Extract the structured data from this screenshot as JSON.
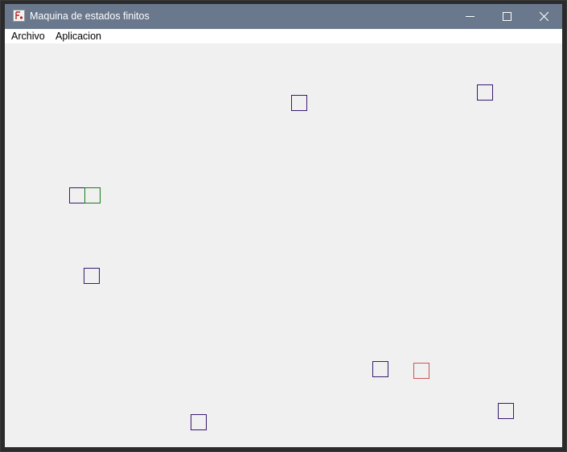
{
  "window": {
    "title": "Maquina de estados finitos",
    "controls": [
      "minimize",
      "maximize",
      "close"
    ]
  },
  "menu": {
    "items": [
      {
        "label": "Archivo"
      },
      {
        "label": "Aplicacion"
      }
    ]
  },
  "canvas": {
    "states": [
      {
        "name": "state-node-1",
        "color": "#3a1a6e"
      },
      {
        "name": "state-node-2",
        "color": "#3a1a6e"
      },
      {
        "name": "state-node-3",
        "color": "#3a1a6e"
      },
      {
        "name": "state-node-4",
        "color": "#1a7a1a"
      },
      {
        "name": "state-node-5",
        "color": "#3a1a6e"
      },
      {
        "name": "state-node-6",
        "color": "#3a1a6e"
      },
      {
        "name": "state-node-7",
        "color": "#cc5555"
      },
      {
        "name": "state-node-8",
        "color": "#3a1a6e"
      },
      {
        "name": "state-node-9",
        "color": "#3a1a6e"
      }
    ]
  }
}
